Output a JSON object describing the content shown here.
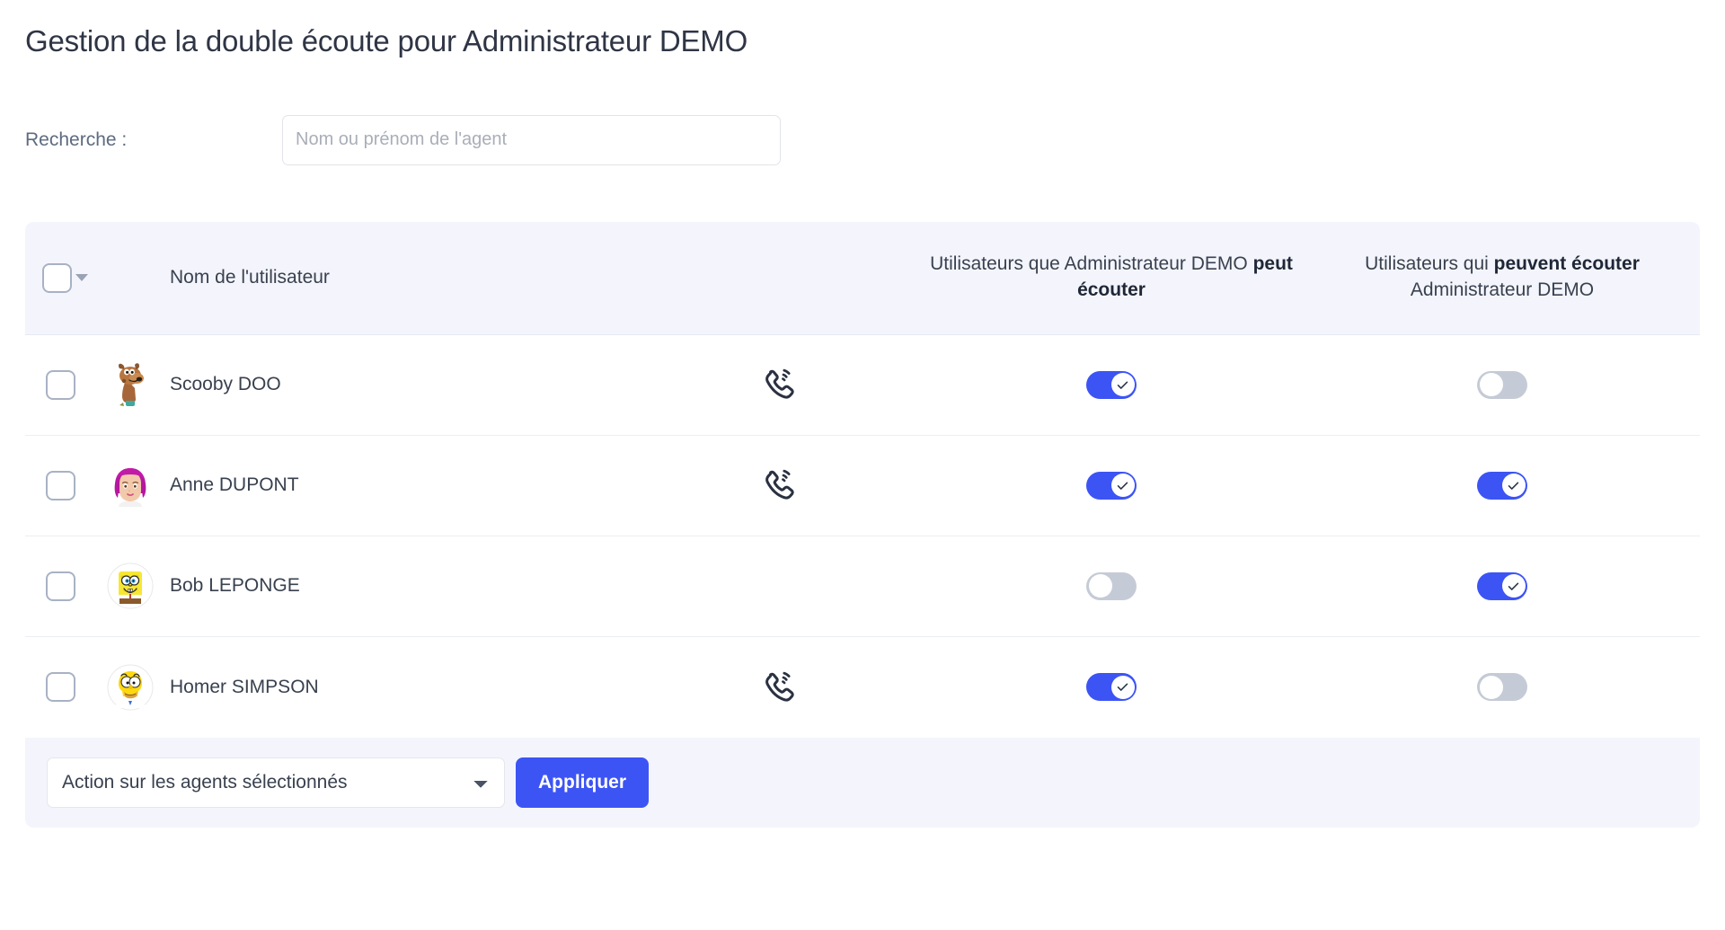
{
  "page_title": "Gestion de la double écoute pour Administrateur DEMO",
  "search": {
    "label": "Recherche :",
    "placeholder": "Nom ou prénom de l'agent",
    "value": ""
  },
  "table": {
    "headers": {
      "name": "Nom de l'utilisateur",
      "can_listen_prefix": "Utilisateurs que Administrateur DEMO ",
      "can_listen_bold": "peut écouter",
      "listened_by_prefix": "Utilisateurs qui ",
      "listened_by_bold": "peuvent écouter",
      "listened_by_suffix": " Administrateur DEMO"
    },
    "rows": [
      {
        "name": "Scooby DOO",
        "avatar": "scooby-doo-avatar",
        "checkbox_checked": false,
        "phone_icon": true,
        "can_listen": true,
        "listened_by": false
      },
      {
        "name": "Anne DUPONT",
        "avatar": "anne-dupont-avatar",
        "checkbox_checked": false,
        "phone_icon": true,
        "can_listen": true,
        "listened_by": true
      },
      {
        "name": "Bob LEPONGE",
        "avatar": "bob-leponge-avatar",
        "checkbox_checked": false,
        "phone_icon": false,
        "can_listen": false,
        "listened_by": true
      },
      {
        "name": "Homer SIMPSON",
        "avatar": "homer-simpson-avatar",
        "checkbox_checked": false,
        "phone_icon": true,
        "can_listen": true,
        "listened_by": false
      }
    ]
  },
  "footer": {
    "action_select_value": "Action sur les agents sélectionnés",
    "action_options": [
      "Action sur les agents sélectionnés"
    ],
    "apply_label": "Appliquer"
  },
  "colors": {
    "accent_blue": "#3d54f4",
    "toggle_off": "#c5cbd6",
    "header_bg": "#f4f5fc",
    "text": "#2b3445"
  },
  "icons": {
    "select_all_caret": "chevron-down-icon",
    "phone": "phone-ringing-icon",
    "toggle_check": "check-icon"
  }
}
